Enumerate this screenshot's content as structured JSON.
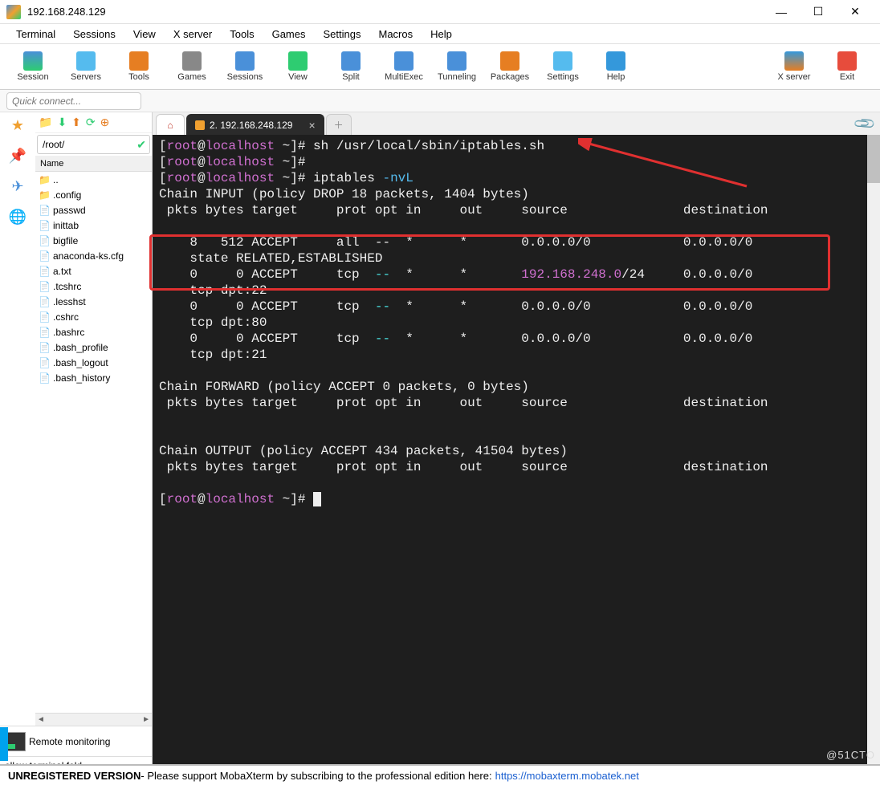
{
  "titlebar": {
    "title": "192.168.248.129"
  },
  "menu": [
    "Terminal",
    "Sessions",
    "View",
    "X server",
    "Tools",
    "Games",
    "Settings",
    "Macros",
    "Help"
  ],
  "toolbar": [
    {
      "label": "Session",
      "color": "linear-gradient(#4a90d9,#2ecc71)"
    },
    {
      "label": "Servers",
      "color": "#55bbee"
    },
    {
      "label": "Tools",
      "color": "#e67e22"
    },
    {
      "label": "Games",
      "color": "#888"
    },
    {
      "label": "Sessions",
      "color": "#4a90d9"
    },
    {
      "label": "View",
      "color": "#2ecc71"
    },
    {
      "label": "Split",
      "color": "#4a90d9"
    },
    {
      "label": "MultiExec",
      "color": "#4a90d9"
    },
    {
      "label": "Tunneling",
      "color": "#4a90d9"
    },
    {
      "label": "Packages",
      "color": "#e67e22"
    },
    {
      "label": "Settings",
      "color": "#55bbee"
    },
    {
      "label": "Help",
      "color": "#3498db"
    }
  ],
  "toolbar_right": [
    {
      "label": "X server",
      "color": "linear-gradient(#3498db,#e67e22)"
    },
    {
      "label": "Exit",
      "color": "#e74c3c"
    }
  ],
  "quickconnect": {
    "placeholder": "Quick connect..."
  },
  "tabs": {
    "active_label": "2. 192.168.248.129"
  },
  "filebrowser": {
    "path": "/root/",
    "header": "Name",
    "items": [
      {
        "name": "..",
        "type": "folder"
      },
      {
        "name": ".config",
        "type": "folder"
      },
      {
        "name": "passwd",
        "type": "file"
      },
      {
        "name": "inittab",
        "type": "file"
      },
      {
        "name": "bigfile",
        "type": "file"
      },
      {
        "name": "anaconda-ks.cfg",
        "type": "file"
      },
      {
        "name": "a.txt",
        "type": "file"
      },
      {
        "name": ".tcshrc",
        "type": "file"
      },
      {
        "name": ".lesshst",
        "type": "file"
      },
      {
        "name": ".cshrc",
        "type": "file"
      },
      {
        "name": ".bashrc",
        "type": "file"
      },
      {
        "name": ".bash_profile",
        "type": "file"
      },
      {
        "name": ".bash_logout",
        "type": "file"
      },
      {
        "name": ".bash_history",
        "type": "file"
      }
    ],
    "remote_monitoring": "Remote monitoring",
    "follow": "ollow terminal fold"
  },
  "terminal": {
    "prompt_user": "root",
    "prompt_host": "localhost",
    "prompt_path": "~",
    "line1_cmd": "sh /usr/local/sbin/iptables.sh",
    "line3_cmd": "iptables ",
    "line3_opt": "-nvL",
    "chain_input": "Chain INPUT (policy DROP 18 packets, 1404 bytes)",
    "header": " pkts bytes target     prot opt in     out     source               destination",
    "r1": "    8   512 ACCEPT     all  --  *      *       0.0.0.0/0            0.0.0.0/0",
    "r1b": "    state RELATED,ESTABLISHED",
    "r2a": "    0     0 ACCEPT     tcp  ",
    "r2b": "  *      *       ",
    "r2net": "192.168.248.0",
    "r2c": "/24     0.0.0.0/0",
    "r2d": "    tcp dpt:22",
    "r3a": "    0     0 ACCEPT     tcp  ",
    "r3b": "  *      *       0.0.0.0/0            0.0.0.0/0",
    "r3c": "    tcp dpt:80",
    "r4a": "    0     0 ACCEPT     tcp  ",
    "r4b": "  *      *       0.0.0.0/0            0.0.0.0/0",
    "r4c": "    tcp dpt:21",
    "chain_forward": "Chain FORWARD (policy ACCEPT 0 packets, 0 bytes)",
    "chain_output": "Chain OUTPUT (policy ACCEPT 434 packets, 41504 bytes)",
    "dashes": "--"
  },
  "statusbar": {
    "unreg": "UNREGISTERED VERSION",
    "msg": "  -  Please support MobaXterm by subscribing to the professional edition here:",
    "link": "https://mobaxterm.mobatek.net"
  },
  "watermark": "@51CTO"
}
